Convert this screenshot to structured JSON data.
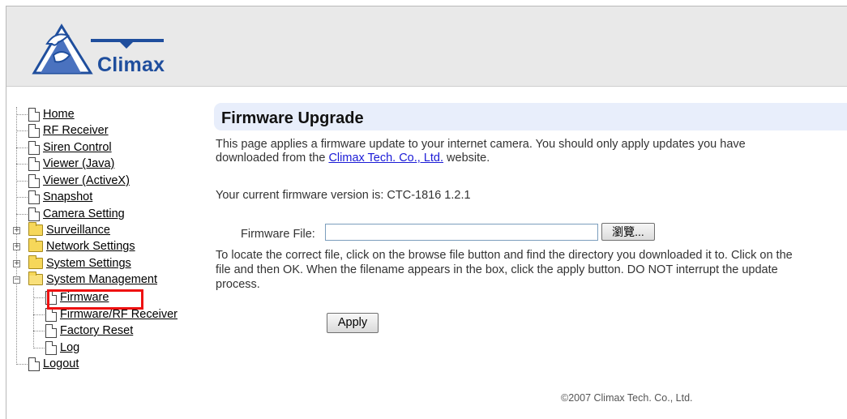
{
  "header": {
    "logo_text": "Climax"
  },
  "nav": {
    "home": "Home",
    "rf_receiver": "RF Receiver",
    "siren_control": "Siren Control",
    "viewer_java": "Viewer (Java)",
    "viewer_activex": "Viewer (ActiveX)",
    "snapshot": "Snapshot",
    "camera_setting": "Camera Setting",
    "surveillance": "Surveillance",
    "network_settings": "Network Settings",
    "system_settings": "System Settings",
    "system_management": "System Management",
    "firmware": "Firmware",
    "firmware_rf": "Firmware/RF Receiver",
    "factory_reset": "Factory Reset",
    "log": "Log",
    "logout": "Logout",
    "expand_glyph": "+",
    "collapse_glyph": "−"
  },
  "main": {
    "title": "Firmware Upgrade",
    "intro_1": "This page applies a firmware update to your internet camera. You should only apply updates you have",
    "intro_2a": "downloaded from the ",
    "intro_link": "Climax Tech. Co., Ltd.",
    "intro_2b": " website.",
    "version_text": "Your current firmware version is: CTC-1816 1.2.1",
    "file_label": "Firmware File:",
    "file_value": "",
    "browse_label": "瀏覽...",
    "help_1": "To locate the correct file, click on the browse file button and find the directory you downloaded it to. Click on the",
    "help_2": "file and then OK. When the filename appears in the box, click the apply button. DO NOT interrupt the update",
    "help_3": "process.",
    "apply_label": "Apply"
  },
  "footer": {
    "copyright": "©2007 Climax Tech. Co., Ltd."
  },
  "colors": {
    "brand": "#1f4e9d",
    "highlight": "#ee1111",
    "title_bar": "#e8eefb"
  }
}
